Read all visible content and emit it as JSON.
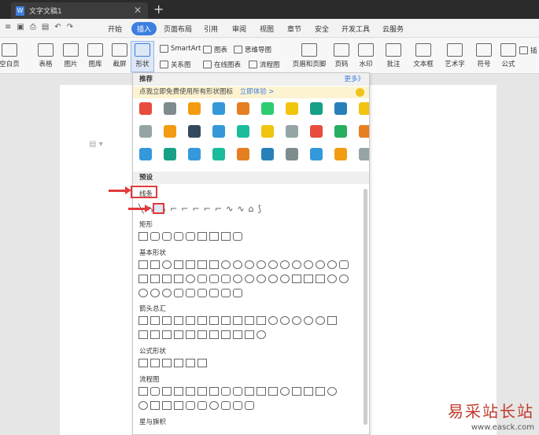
{
  "titlebar": {
    "tab_title": "文字文稿1",
    "new_tab": "+"
  },
  "menu": {
    "items": [
      "开始",
      "插入",
      "页面布局",
      "引用",
      "审阅",
      "视图",
      "章节",
      "安全",
      "开发工具",
      "云服务"
    ],
    "active": "插入"
  },
  "ribbon": {
    "blank_page": "空白页",
    "table": "表格",
    "picture": "图片",
    "gallery": "图库",
    "screenshot": "截屏",
    "shape": "形状",
    "smartart": "SmartArt",
    "chart": "图表",
    "mindmap": "思维导图",
    "relation": "关系图",
    "online_chart": "在线图表",
    "flowchart": "流程图",
    "header_footer": "页眉和页脚",
    "page_number": "页码",
    "watermark": "水印",
    "comment": "批注",
    "textbox": "文本框",
    "art_text": "艺术字",
    "symbol": "符号",
    "formula": "公式",
    "insert_more": "插"
  },
  "panel": {
    "recommend": "推荐",
    "more": "更多》",
    "banner_text": "点我立即免费使用所有形状图标",
    "banner_link": "立即体验 >",
    "preset": "预设",
    "sections": {
      "lines": "线条",
      "rect": "矩形",
      "basic": "基本形状",
      "arrows": "箭头总汇",
      "formula": "公式形状",
      "flow": "流程图",
      "stars": "星与旗帜"
    }
  },
  "watermark": {
    "line1": "易采站长站",
    "line2": "www.easck.com"
  },
  "colors": {
    "accent": "#3d7fe0",
    "highlight": "#e23b3b"
  }
}
